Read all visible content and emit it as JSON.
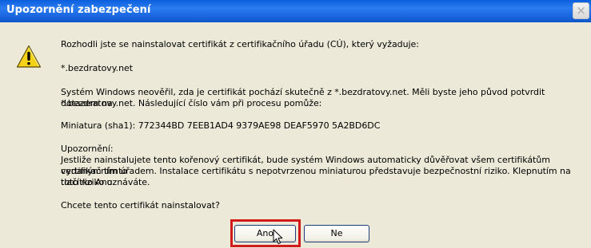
{
  "window": {
    "title": "Upozornění zabezpečení",
    "close_symbol": "×"
  },
  "message": {
    "intro": "Rozhodli jste se nainstalovat certifikát z certifikačního úřadu (CÚ), který vyžaduje:",
    "domain": "*.bezdratovy.net",
    "verify_line1": "Systém Windows neověřil, zda je certifikát pochází skutečně z *.bezdratovy.net. Měli byste jeho původ potvrdit dotazem na",
    "verify_line2": "*.bezdratovy.net. Následující číslo vám při procesu pomůže:",
    "thumbprint": "Miniatura (sha1): 772344BD 7EEB1AD4 9379AE98 DEAF5970 5A2BD6DC",
    "warning_heading": "Upozornění:",
    "warning_line1": "Jestliže nainstalujete tento kořenový certifikát, bude systém Windows automaticky důvěřovat všem certifikátům vydaným tímto",
    "warning_line2": "certifikačním úřadem. Instalace certifikátu s nepotvrzenou miniaturou představuje bezpečnostní riziko. Klepnutím na tlačítko Ano",
    "warning_line3": "toto riziko uznáváte.",
    "question": "Chcete tento certifikát nainstalovat?"
  },
  "buttons": {
    "yes": "Ano",
    "no": "Ne"
  },
  "icons": {
    "warning": "warning-icon",
    "close": "close-icon",
    "cursor": "mouse-cursor-icon"
  },
  "colors": {
    "titlebar": "#1E6BE3",
    "dialog_bg": "#ECE9D8",
    "highlight": "#D11A1A",
    "warning_fill": "#F5D21A"
  }
}
